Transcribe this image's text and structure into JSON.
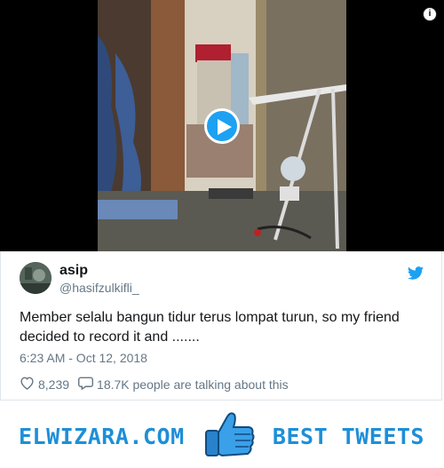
{
  "tweet": {
    "author_name": "asip",
    "author_handle": "@hasifzulkifli_",
    "text": "Member selalu bangun tidur terus lompat turun, so my friend decided to record it and .......",
    "timestamp": "6:23 AM - Oct 12, 2018",
    "like_count": "8,239",
    "talking_text": "18.7K people are talking about this"
  },
  "video": {
    "info_label": "i"
  },
  "banner": {
    "left_text": "ELWIZARA.COM",
    "right_text": "BEST TWEETS"
  },
  "colors": {
    "twitter_blue": "#1da1f2",
    "banner_blue": "#1d8fd8",
    "text_dark": "#14171a",
    "text_gray": "#657786"
  },
  "icons": [
    "info-icon",
    "play-icon",
    "twitter-bird-icon",
    "heart-icon",
    "comment-icon",
    "thumbs-up-icon"
  ]
}
